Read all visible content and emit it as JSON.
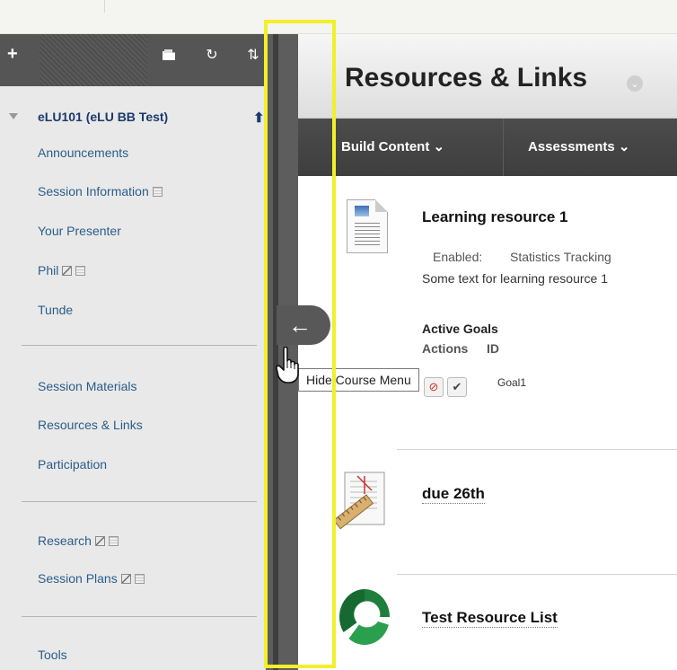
{
  "sidebar": {
    "toolbar": {
      "add_icon": "plus-icon",
      "folder_icon": "folder-icon",
      "refresh_icon": "refresh-icon",
      "reorder_icon": "reorder-icon"
    },
    "course_title": "eLU101 (eLU BB Test)",
    "items": [
      {
        "label": "Announcements"
      },
      {
        "label": "Session Information"
      },
      {
        "label": "Your Presenter"
      },
      {
        "label": "Phil"
      },
      {
        "label": "Tunde"
      },
      {
        "label": "Session Materials"
      },
      {
        "label": "Resources & Links"
      },
      {
        "label": "Participation"
      },
      {
        "label": "Research"
      },
      {
        "label": "Session Plans"
      },
      {
        "label": "Tools"
      }
    ]
  },
  "collapse": {
    "tooltip": "Hide Course Menu",
    "arrow": "←"
  },
  "page": {
    "title": "Resources & Links",
    "actions": [
      {
        "label": "Build Content ⌄"
      },
      {
        "label": "Assessments ⌄"
      }
    ]
  },
  "content_items": [
    {
      "title": "Learning resource 1",
      "enabled_label": "Enabled:",
      "enabled_value": "Statistics Tracking",
      "description": "Some text for learning resource 1",
      "goals_header": "Active Goals",
      "goals_columns": [
        "Actions",
        "ID"
      ],
      "goal_id": "Goal1"
    },
    {
      "title": "due 26th"
    },
    {
      "title": "Test Resource List"
    }
  ],
  "colors": {
    "highlight": "#f1f02b",
    "sidebar_link": "#2a5d8a",
    "course_title": "#1b3a6b",
    "action_bar": "#444444"
  }
}
